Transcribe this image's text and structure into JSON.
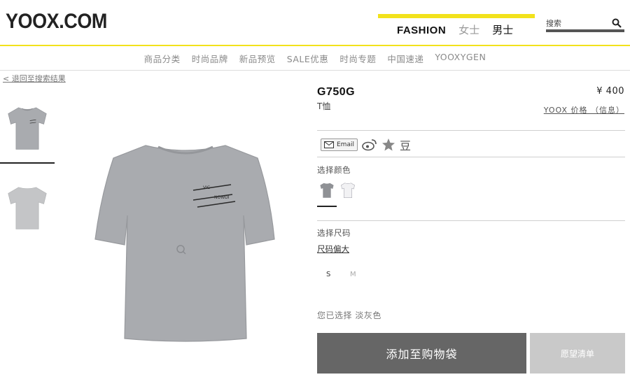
{
  "header": {
    "logo": "YOOX.COM",
    "nav": {
      "fashion": "FASHION",
      "women": "女士",
      "men": "男士"
    },
    "search_placeholder": "搜索"
  },
  "category_nav": [
    "商品分类",
    "时尚品牌",
    "新品预览",
    "SALE优惠",
    "时尚专题",
    "中国速递",
    "YOOXYGEN"
  ],
  "back_link": "< 退回至搜索结果",
  "product": {
    "brand": "G750G",
    "type": "T恤",
    "price": "¥ 400",
    "price_info": "YOOX 价格 （信息）",
    "share": {
      "email": "Email",
      "douban": "豆"
    },
    "color_label": "选择颜色",
    "size_label": "选择尺码",
    "size_guide": "尺码偏大",
    "sizes": [
      "S",
      "M"
    ],
    "selected_text": "您已选择 淡灰色",
    "add_to_bag": "添加至购物袋",
    "wishlist": "愿望清单"
  },
  "colors": {
    "accent_yellow": "#f2e21b",
    "button_dark": "#666666",
    "button_light": "#c9c9c9",
    "shirt_grey": "#a9abaf"
  }
}
